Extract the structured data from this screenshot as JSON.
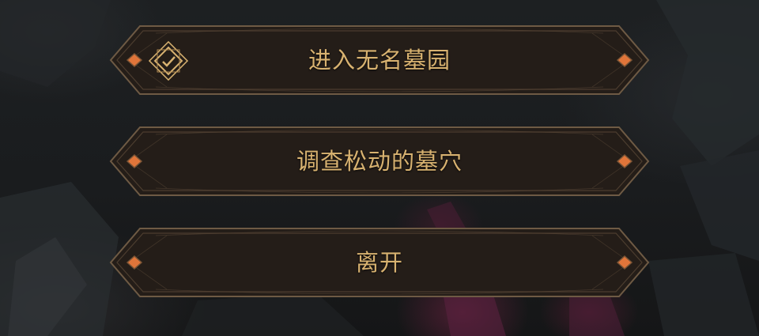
{
  "dialogue": {
    "options": [
      {
        "label": "进入无名墓园",
        "selected": true,
        "icon": "selected-check-icon"
      },
      {
        "label": "调查松动的墓穴",
        "selected": false
      },
      {
        "label": "离开",
        "selected": false
      }
    ]
  },
  "colors": {
    "text": "#d8b270",
    "frame_border": "#6e5a44",
    "gem": "#e0753a",
    "panel": "#241d18"
  }
}
